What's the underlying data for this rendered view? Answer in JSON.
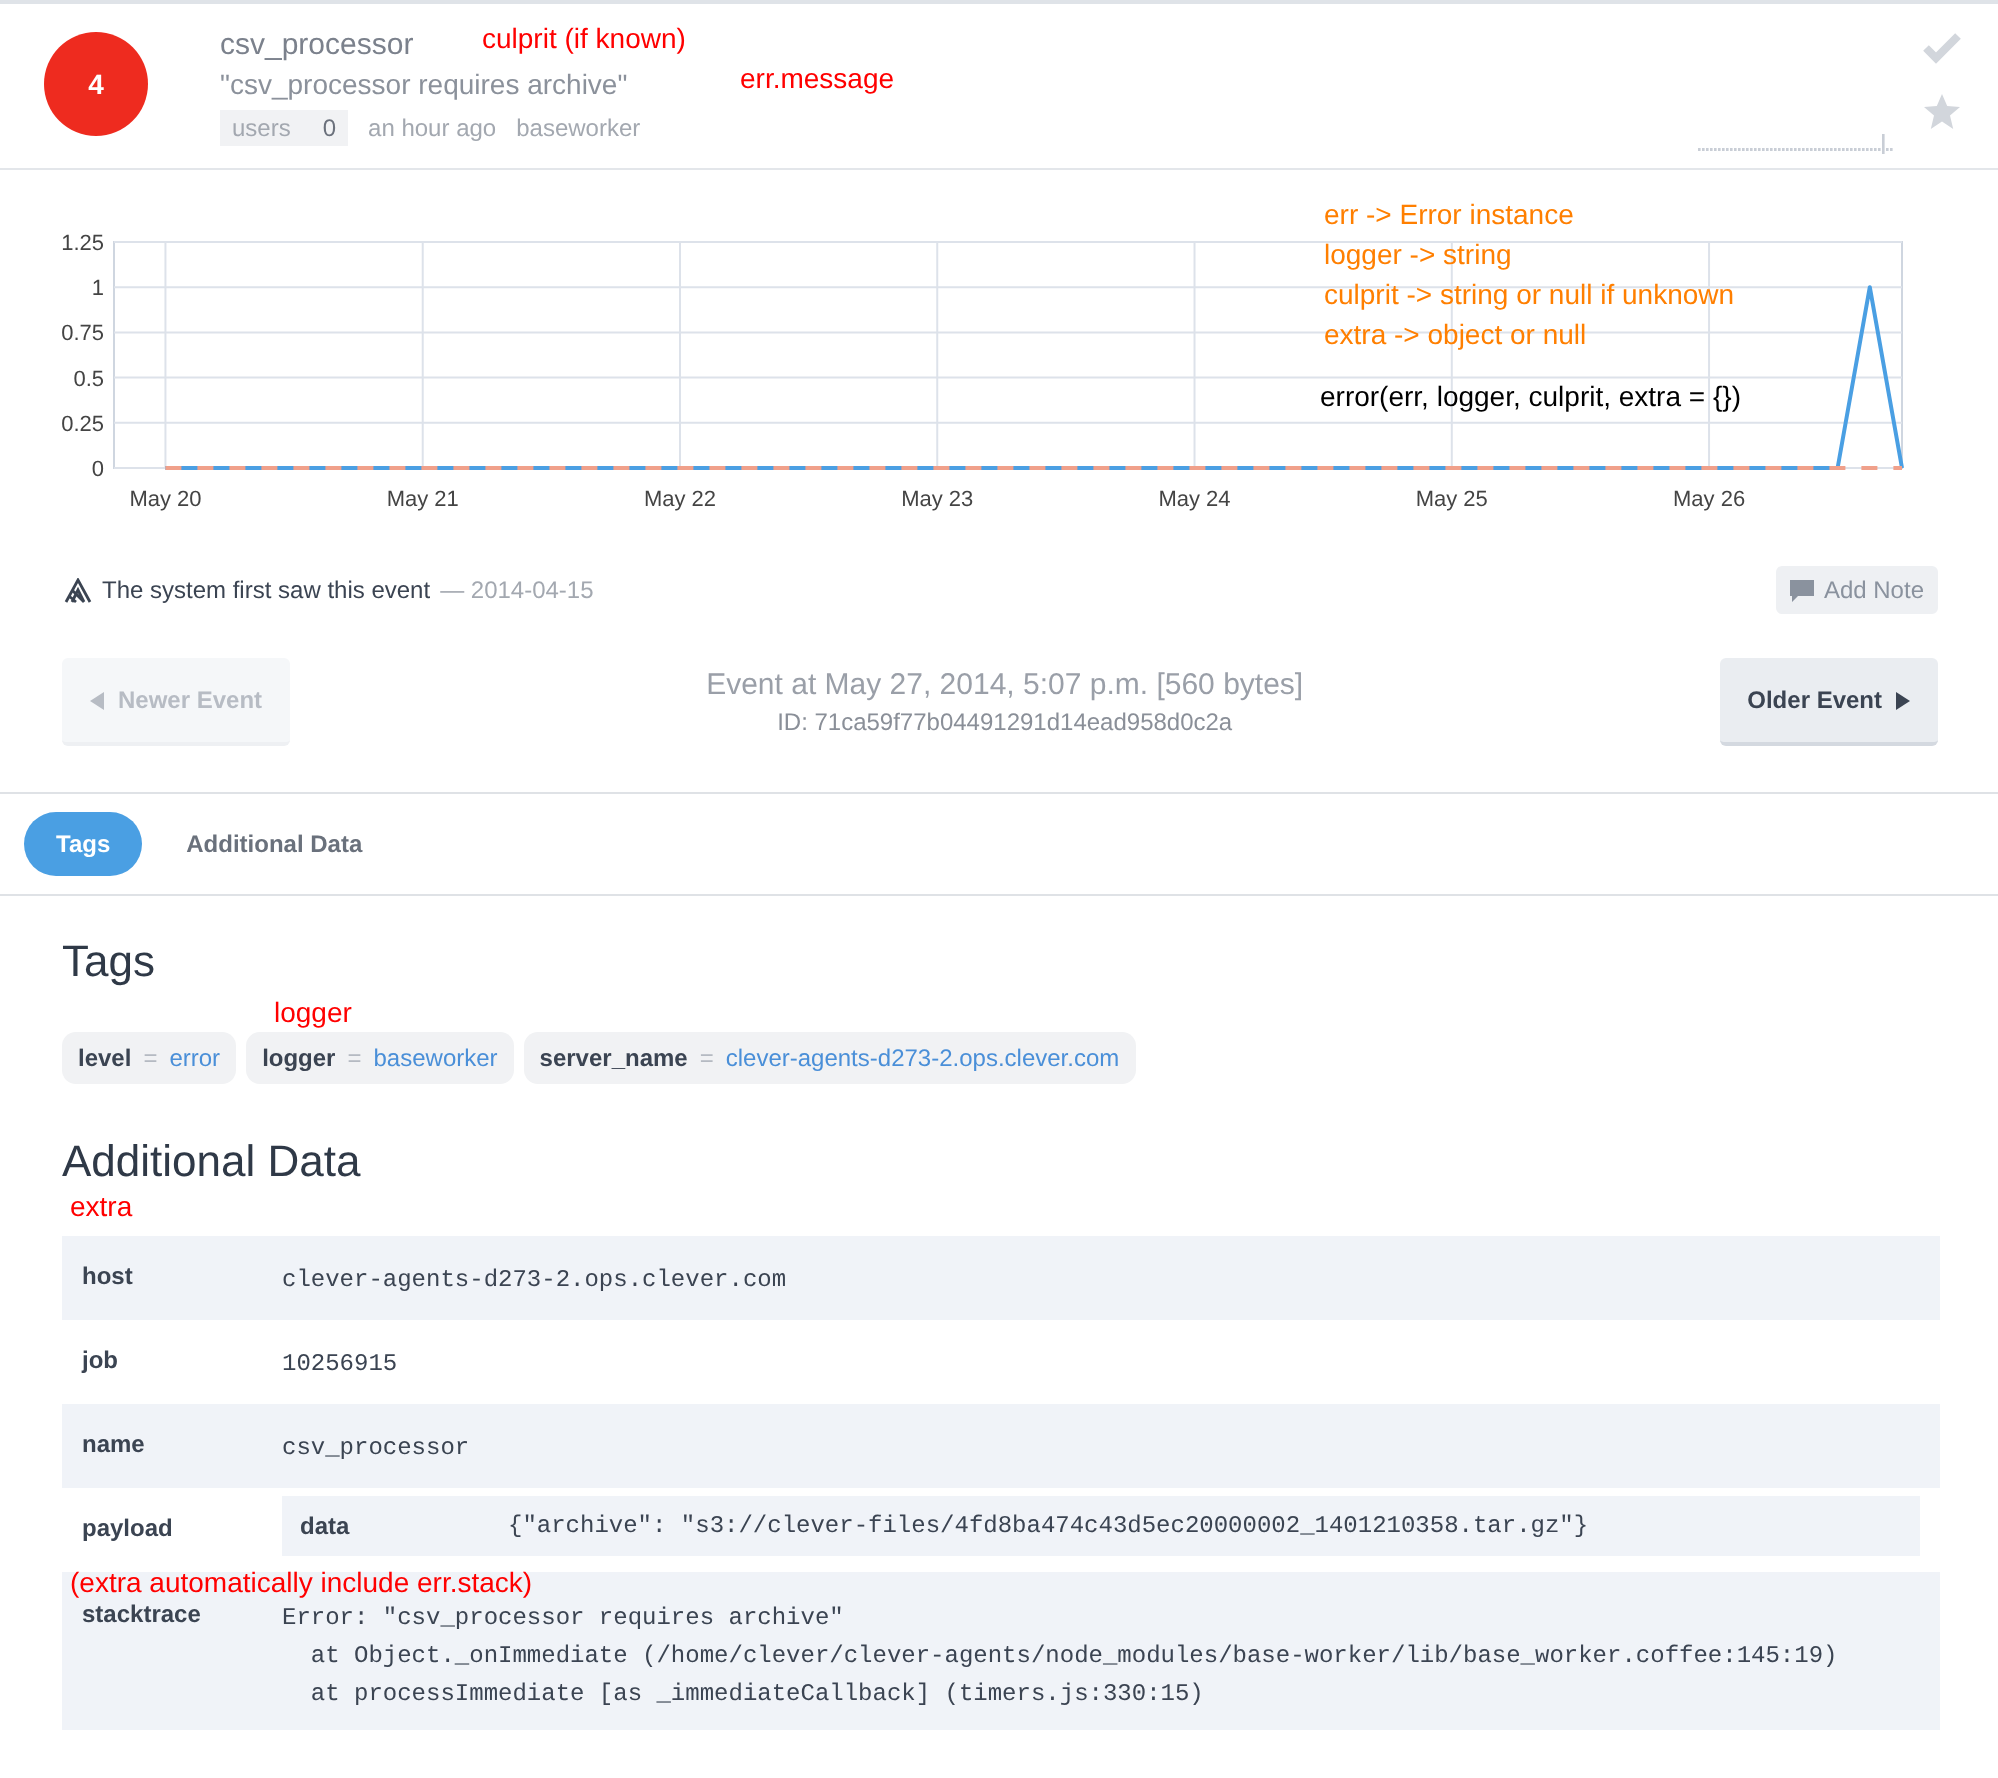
{
  "header": {
    "count": "4",
    "culprit": "csv_processor",
    "message": "\"csv_processor requires archive\"",
    "users_label": "users",
    "users_count": "0",
    "time": "an hour ago",
    "logger": "baseworker"
  },
  "chart": {
    "chart_data": {
      "type": "line",
      "grid": true,
      "categories": [
        "May 20",
        null,
        null,
        null,
        null,
        null,
        null,
        null,
        "May 21",
        null,
        null,
        null,
        null,
        null,
        null,
        null,
        "May 22",
        null,
        null,
        null,
        null,
        null,
        null,
        null,
        "May 23",
        null,
        null,
        null,
        null,
        null,
        null,
        null,
        "May 24",
        null,
        null,
        null,
        null,
        null,
        null,
        null,
        "May 25",
        null,
        null,
        null,
        null,
        null,
        null,
        null,
        "May 26",
        null,
        null,
        null,
        null,
        null,
        null
      ],
      "series": [
        {
          "color": "#4a9fe3",
          "line_style": "solid",
          "values": [
            0,
            0,
            0,
            0,
            0,
            0,
            0,
            0,
            0,
            0,
            0,
            0,
            0,
            0,
            0,
            0,
            0,
            0,
            0,
            0,
            0,
            0,
            0,
            0,
            0,
            0,
            0,
            0,
            0,
            0,
            0,
            0,
            0,
            0,
            0,
            0,
            0,
            0,
            0,
            0,
            0,
            0,
            0,
            0,
            0,
            0,
            0,
            0,
            0,
            0,
            0,
            0,
            0,
            1,
            0
          ]
        },
        {
          "color": "#f0a08a",
          "line_style": "dashed",
          "values": [
            0,
            0,
            0,
            0,
            0,
            0,
            0,
            0,
            0,
            0,
            0,
            0,
            0,
            0,
            0,
            0,
            0,
            0,
            0,
            0,
            0,
            0,
            0,
            0,
            0,
            0,
            0,
            0,
            0,
            0,
            0,
            0,
            0,
            0,
            0,
            0,
            0,
            0,
            0,
            0,
            0,
            0,
            0,
            0,
            0,
            0,
            0,
            0,
            0,
            0,
            0,
            0,
            0,
            0,
            0
          ]
        }
      ],
      "ylim": [
        0,
        1.25
      ],
      "yticks": [
        {
          "value": 0,
          "label": "0"
        },
        {
          "value": 0.25,
          "label": "0.25"
        },
        {
          "value": 0.5,
          "label": "0.5"
        },
        {
          "value": 0.75,
          "label": "0.75"
        },
        {
          "value": 1,
          "label": "1"
        },
        {
          "value": 1.25,
          "label": "1.25"
        }
      ]
    }
  },
  "first_seen": {
    "text": "The system first saw this event",
    "dash": "—",
    "date": "2014-04-15",
    "button": "Add Note"
  },
  "event_nav": {
    "newer": {
      "label": "Newer Event",
      "disabled": true
    },
    "title": "Event at May 27, 2014, 5:07 p.m. [560 bytes]",
    "id": "ID: 71ca59f77b04491291d14ead958d0c2a",
    "older": {
      "label": "Older Event",
      "disabled": false
    }
  },
  "tabs": [
    {
      "label": "Tags",
      "selected": true
    },
    {
      "label": "Additional Data",
      "selected": false
    }
  ],
  "tags_section": {
    "title": "Tags",
    "tags": [
      {
        "key": "level",
        "eq": "=",
        "value": "error"
      },
      {
        "key": "logger",
        "eq": "=",
        "value": "baseworker"
      },
      {
        "key": "server_name",
        "eq": "=",
        "value": "clever-agents-d273-2.ops.clever.com"
      }
    ]
  },
  "additional_data": {
    "title": "Additional Data",
    "rows": [
      {
        "key": "host",
        "kind": "text",
        "value": [
          "clever-agents-d273-2.ops.clever.com"
        ]
      },
      {
        "key": "job",
        "kind": "text",
        "value": [
          "10256915"
        ]
      },
      {
        "key": "name",
        "kind": "text",
        "value": [
          "csv_processor"
        ]
      },
      {
        "key": "payload",
        "kind": "nested",
        "nested_key": "data",
        "value": [
          "{\"archive\": \"s3://clever-files/4fd8ba474c43d5ec20000002_1401210358.tar.gz\"}"
        ]
      },
      {
        "key": "stacktrace",
        "kind": "text",
        "value": [
          "Error: \"csv_processor requires archive\"",
          "  at Object._onImmediate (/home/clever/clever-agents/node_modules/base-worker/lib/base_worker.coffee:145:19)",
          "  at processImmediate [as _immediateCallback] (timers.js:330:15)"
        ]
      }
    ]
  },
  "annotations": [
    {
      "text": "culprit (if known)",
      "color": "#ff0000"
    },
    {
      "text": "err.message",
      "color": "#ff0000"
    },
    {
      "text": "err -> Error instance",
      "color": "#ff7f00"
    },
    {
      "text": "logger -> string",
      "color": "#ff7f00"
    },
    {
      "text": "culprit -> string or null if unknown",
      "color": "#ff7f00"
    },
    {
      "text": "extra -> object or null",
      "color": "#ff7f00"
    },
    {
      "text": "error(err, logger, culprit, extra = {})",
      "color": "#000000"
    },
    {
      "text": "logger",
      "color": "#ff0000"
    },
    {
      "text": "extra",
      "color": "#ff0000"
    },
    {
      "text": "(extra automatically include err.stack)",
      "color": "#ff0000"
    }
  ]
}
